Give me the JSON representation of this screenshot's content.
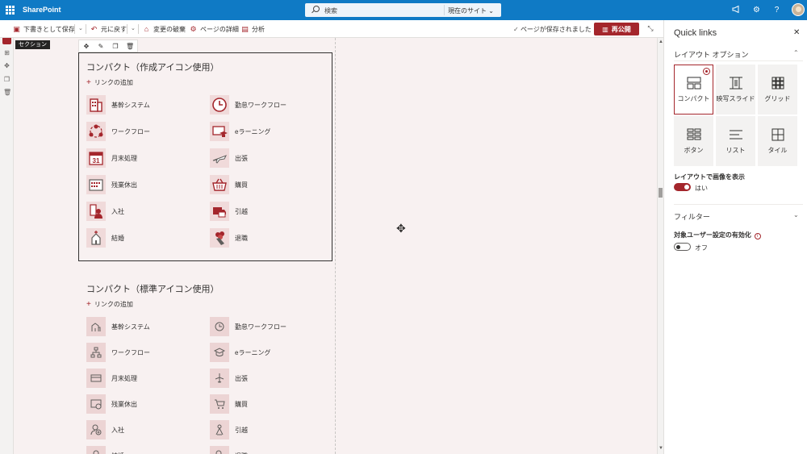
{
  "suite": {
    "brand": "SharePoint",
    "search_placeholder": "検索",
    "search_scope": "現在のサイト"
  },
  "commands": {
    "save_draft": "下書きとして保存",
    "undo": "元に戻す",
    "discard": "変更の破棄",
    "page_details": "ページの詳細",
    "analytics": "分析",
    "saved_status": "ページが保存されました",
    "republish": "再公開"
  },
  "canvas": {
    "section_tag": "セクション",
    "webpart1": {
      "title": "コンパクト（作成アイコン使用）",
      "add_link": "リンクの追加",
      "links": [
        "基幹システム",
        "勤怠ワークフロー",
        "ワークフロー",
        "eラーニング",
        "月末処理",
        "出張",
        "残業休出",
        "購買",
        "入社",
        "引越",
        "結婚",
        "退職"
      ],
      "calendar_number": "31"
    },
    "webpart2": {
      "title": "コンパクト（標準アイコン使用）",
      "add_link": "リンクの追加",
      "links": [
        "基幹システム",
        "勤怠ワークフロー",
        "ワークフロー",
        "eラーニング",
        "月末処理",
        "出張",
        "残業休出",
        "購買",
        "入社",
        "引越",
        "結婚",
        "退職"
      ]
    }
  },
  "panel": {
    "title": "Quick links",
    "layout_header": "レイアウト オプション",
    "layouts": [
      "コンパクト",
      "映写スライド",
      "グリッド",
      "ボタン",
      "リスト",
      "タイル"
    ],
    "selected_layout": "コンパクト",
    "show_image_label": "レイアウトで画像を表示",
    "show_image_value": "はい",
    "filter_header": "フィルター",
    "audience_label": "対象ユーザー設定の有効化",
    "audience_value": "オフ"
  },
  "colors": {
    "suite_blue": "#0f7ac5",
    "accent": "#a4262c",
    "canvas_bg": "#f8f1f1"
  }
}
